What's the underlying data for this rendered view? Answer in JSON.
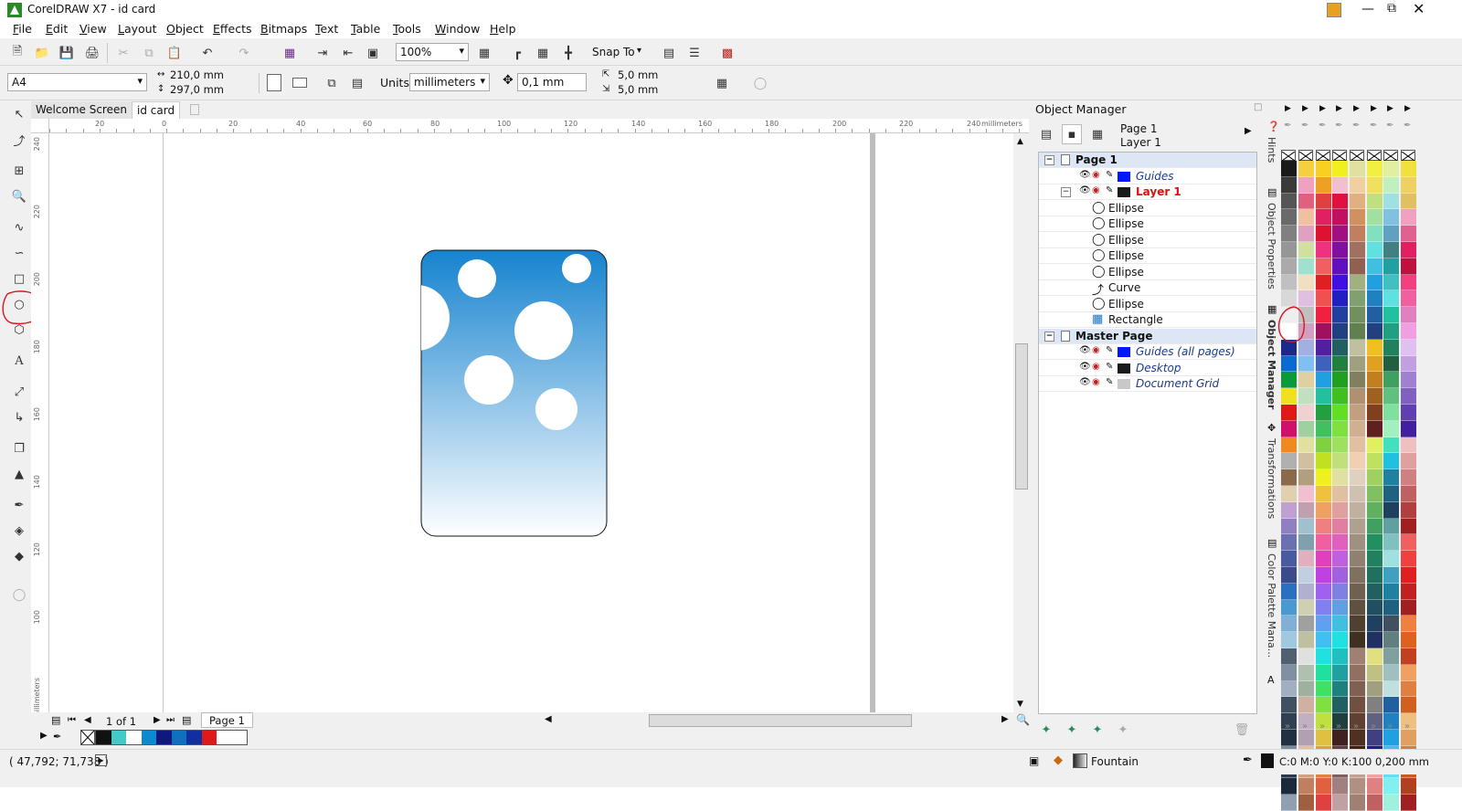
{
  "window": {
    "title": "CorelDRAW X7 - id card"
  },
  "menu": [
    "File",
    "Edit",
    "View",
    "Layout",
    "Object",
    "Effects",
    "Bitmaps",
    "Text",
    "Table",
    "Tools",
    "Window",
    "Help"
  ],
  "toolbar": {
    "zoom": "100%",
    "snap_label": "Snap To"
  },
  "property_bar": {
    "page_size": "A4",
    "width": "210,0 mm",
    "height": "297,0 mm",
    "units_label": "Units:",
    "units_value": "millimeters",
    "nudge": "0,1 mm",
    "dup_x": "5,0 mm",
    "dup_y": "5,0 mm"
  },
  "doc_tabs": [
    "Welcome Screen",
    "id card"
  ],
  "ruler": {
    "unit": "millimeters",
    "h_ticks": [
      "20",
      "0",
      "20",
      "40",
      "60",
      "80",
      "100",
      "120",
      "140",
      "160",
      "180",
      "200",
      "220",
      "240"
    ],
    "v_ticks": [
      "240",
      "220",
      "200",
      "180",
      "160",
      "140",
      "120",
      "100"
    ],
    "v_unit": "millimeters"
  },
  "page_nav": {
    "counter": "1 of 1",
    "page_tab": "Page 1"
  },
  "object_manager": {
    "title": "Object Manager",
    "current_page": "Page 1",
    "current_layer": "Layer 1",
    "tree": [
      {
        "label": "Page 1",
        "type": "page"
      },
      {
        "label": "Guides",
        "type": "layer",
        "color": "#0018ff"
      },
      {
        "label": "Layer 1",
        "type": "layer-active",
        "color": "#1a1a1a"
      },
      {
        "label": "Ellipse",
        "type": "object",
        "icon": "ellipse-icon"
      },
      {
        "label": "Ellipse",
        "type": "object",
        "icon": "ellipse-icon"
      },
      {
        "label": "Ellipse",
        "type": "object",
        "icon": "ellipse-icon"
      },
      {
        "label": "Ellipse",
        "type": "object",
        "icon": "ellipse-icon"
      },
      {
        "label": "Ellipse",
        "type": "object",
        "icon": "ellipse-icon"
      },
      {
        "label": "Curve",
        "type": "object",
        "icon": "curve-icon"
      },
      {
        "label": "Ellipse",
        "type": "object",
        "icon": "ellipse-icon"
      },
      {
        "label": "Rectangle",
        "type": "object",
        "icon": "rectangle-icon"
      },
      {
        "label": "Master Page",
        "type": "page"
      },
      {
        "label": "Guides (all pages)",
        "type": "layer",
        "color": "#0018ff"
      },
      {
        "label": "Desktop",
        "type": "layer",
        "color": "#1a1a1a"
      },
      {
        "label": "Document Grid",
        "type": "layer",
        "color": "#c8c8c8"
      }
    ]
  },
  "dockers": [
    "Hints",
    "Object Properties",
    "Object Manager",
    "Transformations",
    "Color Palette Mana..."
  ],
  "status": {
    "coords": "( 47,792; 71,738 )",
    "fill_label": "Fountain",
    "outline": "C:0 M:0 Y:0 K:100  0,200 mm"
  },
  "document_palette": [
    "#111111",
    "#44c8c8",
    "#ffffff",
    "#0a8ad0",
    "#101880",
    "#1070c0",
    "#1030a0",
    "#e01818",
    "#ffffff",
    "#ffffff"
  ],
  "colors": {
    "card_top": "#1683cf",
    "card_bottom": "#ffffff",
    "accent": "#0018ff",
    "annotation": "#e0121c"
  }
}
